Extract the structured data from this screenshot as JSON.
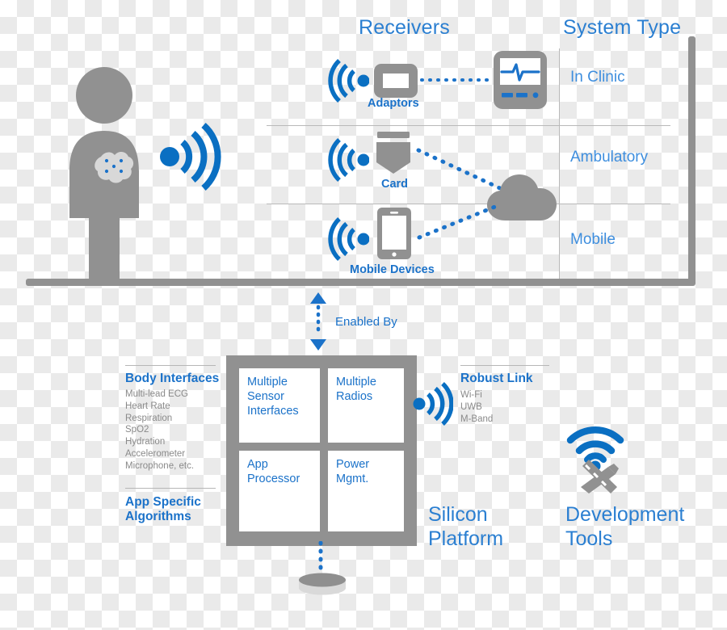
{
  "diagram": {
    "title_receivers": "Receivers",
    "title_system_type": "System Type",
    "enabled_by": "Enabled By"
  },
  "receivers": [
    {
      "id": "adaptors",
      "label": "Adaptors",
      "icon": "adaptor-icon",
      "system_type": "In Clinic"
    },
    {
      "id": "card",
      "label": "Card",
      "icon": "card-icon",
      "system_type": "Ambulatory"
    },
    {
      "id": "mobile-devices",
      "label": "Mobile Devices",
      "icon": "smartphone-icon",
      "system_type": "Mobile"
    }
  ],
  "system_types": [
    {
      "label": "In Clinic"
    },
    {
      "label": "Ambulatory"
    },
    {
      "label": "Mobile"
    }
  ],
  "icons": {
    "person": "person-icon",
    "body_sensor_patch": "sensor-patch-icon",
    "wifi_person": "wifi-signal-icon",
    "clinic_monitor": "patient-monitor-icon",
    "cloud": "cloud-icon",
    "wifi_radio": "wifi-signal-icon",
    "dev_tools": "wifi-tools-icon",
    "coin_cell": "coin-cell-battery-icon",
    "arrow_up": "arrow-up-icon",
    "arrow_down": "arrow-down-icon"
  },
  "left_panel": {
    "body_interfaces": {
      "title": "Body Interfaces",
      "items": [
        "Multi-lead ECG",
        "Heart Rate",
        "Respiration",
        "SpO2",
        "Hydration",
        "Accelerometer",
        "Microphone, etc."
      ]
    },
    "app_specific": {
      "title": "App Specific\nAlgorithms",
      "line1": "App Specific",
      "line2": "Algorithms"
    }
  },
  "right_panel": {
    "robust_link": {
      "title": "Robust Link",
      "items": [
        "Wi-Fi",
        "UWB",
        "M-Band"
      ]
    }
  },
  "silicon_platform": {
    "caption_line1": "Silicon",
    "caption_line2": "Platform",
    "quadrants": [
      {
        "id": "multiple-sensor-interfaces",
        "lines": [
          "Multiple",
          "Sensor",
          "Interfaces"
        ]
      },
      {
        "id": "multiple-radios",
        "lines": [
          "Multiple",
          "Radios"
        ]
      },
      {
        "id": "app-processor",
        "lines": [
          "App",
          "Processor"
        ]
      },
      {
        "id": "power-mgmt",
        "lines": [
          "Power",
          "Mgmt."
        ]
      }
    ]
  },
  "development_tools": {
    "caption_line1": "Development",
    "caption_line2": "Tools"
  },
  "colors": {
    "blue": "#1b72c9",
    "blue_light": "#3e8ede",
    "gray": "#919191",
    "gray_rule": "#b6b6b6",
    "white": "#ffffff"
  }
}
